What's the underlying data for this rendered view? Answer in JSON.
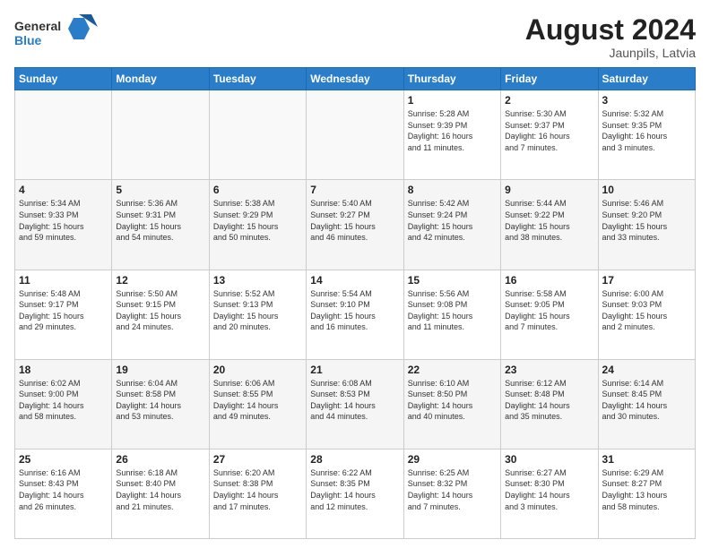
{
  "header": {
    "logo_general": "General",
    "logo_blue": "Blue",
    "month_title": "August 2024",
    "location": "Jaunpils, Latvia"
  },
  "days_of_week": [
    "Sunday",
    "Monday",
    "Tuesday",
    "Wednesday",
    "Thursday",
    "Friday",
    "Saturday"
  ],
  "weeks": [
    [
      {
        "day": "",
        "info": ""
      },
      {
        "day": "",
        "info": ""
      },
      {
        "day": "",
        "info": ""
      },
      {
        "day": "",
        "info": ""
      },
      {
        "day": "1",
        "info": "Sunrise: 5:28 AM\nSunset: 9:39 PM\nDaylight: 16 hours\nand 11 minutes."
      },
      {
        "day": "2",
        "info": "Sunrise: 5:30 AM\nSunset: 9:37 PM\nDaylight: 16 hours\nand 7 minutes."
      },
      {
        "day": "3",
        "info": "Sunrise: 5:32 AM\nSunset: 9:35 PM\nDaylight: 16 hours\nand 3 minutes."
      }
    ],
    [
      {
        "day": "4",
        "info": "Sunrise: 5:34 AM\nSunset: 9:33 PM\nDaylight: 15 hours\nand 59 minutes."
      },
      {
        "day": "5",
        "info": "Sunrise: 5:36 AM\nSunset: 9:31 PM\nDaylight: 15 hours\nand 54 minutes."
      },
      {
        "day": "6",
        "info": "Sunrise: 5:38 AM\nSunset: 9:29 PM\nDaylight: 15 hours\nand 50 minutes."
      },
      {
        "day": "7",
        "info": "Sunrise: 5:40 AM\nSunset: 9:27 PM\nDaylight: 15 hours\nand 46 minutes."
      },
      {
        "day": "8",
        "info": "Sunrise: 5:42 AM\nSunset: 9:24 PM\nDaylight: 15 hours\nand 42 minutes."
      },
      {
        "day": "9",
        "info": "Sunrise: 5:44 AM\nSunset: 9:22 PM\nDaylight: 15 hours\nand 38 minutes."
      },
      {
        "day": "10",
        "info": "Sunrise: 5:46 AM\nSunset: 9:20 PM\nDaylight: 15 hours\nand 33 minutes."
      }
    ],
    [
      {
        "day": "11",
        "info": "Sunrise: 5:48 AM\nSunset: 9:17 PM\nDaylight: 15 hours\nand 29 minutes."
      },
      {
        "day": "12",
        "info": "Sunrise: 5:50 AM\nSunset: 9:15 PM\nDaylight: 15 hours\nand 24 minutes."
      },
      {
        "day": "13",
        "info": "Sunrise: 5:52 AM\nSunset: 9:13 PM\nDaylight: 15 hours\nand 20 minutes."
      },
      {
        "day": "14",
        "info": "Sunrise: 5:54 AM\nSunset: 9:10 PM\nDaylight: 15 hours\nand 16 minutes."
      },
      {
        "day": "15",
        "info": "Sunrise: 5:56 AM\nSunset: 9:08 PM\nDaylight: 15 hours\nand 11 minutes."
      },
      {
        "day": "16",
        "info": "Sunrise: 5:58 AM\nSunset: 9:05 PM\nDaylight: 15 hours\nand 7 minutes."
      },
      {
        "day": "17",
        "info": "Sunrise: 6:00 AM\nSunset: 9:03 PM\nDaylight: 15 hours\nand 2 minutes."
      }
    ],
    [
      {
        "day": "18",
        "info": "Sunrise: 6:02 AM\nSunset: 9:00 PM\nDaylight: 14 hours\nand 58 minutes."
      },
      {
        "day": "19",
        "info": "Sunrise: 6:04 AM\nSunset: 8:58 PM\nDaylight: 14 hours\nand 53 minutes."
      },
      {
        "day": "20",
        "info": "Sunrise: 6:06 AM\nSunset: 8:55 PM\nDaylight: 14 hours\nand 49 minutes."
      },
      {
        "day": "21",
        "info": "Sunrise: 6:08 AM\nSunset: 8:53 PM\nDaylight: 14 hours\nand 44 minutes."
      },
      {
        "day": "22",
        "info": "Sunrise: 6:10 AM\nSunset: 8:50 PM\nDaylight: 14 hours\nand 40 minutes."
      },
      {
        "day": "23",
        "info": "Sunrise: 6:12 AM\nSunset: 8:48 PM\nDaylight: 14 hours\nand 35 minutes."
      },
      {
        "day": "24",
        "info": "Sunrise: 6:14 AM\nSunset: 8:45 PM\nDaylight: 14 hours\nand 30 minutes."
      }
    ],
    [
      {
        "day": "25",
        "info": "Sunrise: 6:16 AM\nSunset: 8:43 PM\nDaylight: 14 hours\nand 26 minutes."
      },
      {
        "day": "26",
        "info": "Sunrise: 6:18 AM\nSunset: 8:40 PM\nDaylight: 14 hours\nand 21 minutes."
      },
      {
        "day": "27",
        "info": "Sunrise: 6:20 AM\nSunset: 8:38 PM\nDaylight: 14 hours\nand 17 minutes."
      },
      {
        "day": "28",
        "info": "Sunrise: 6:22 AM\nSunset: 8:35 PM\nDaylight: 14 hours\nand 12 minutes."
      },
      {
        "day": "29",
        "info": "Sunrise: 6:25 AM\nSunset: 8:32 PM\nDaylight: 14 hours\nand 7 minutes."
      },
      {
        "day": "30",
        "info": "Sunrise: 6:27 AM\nSunset: 8:30 PM\nDaylight: 14 hours\nand 3 minutes."
      },
      {
        "day": "31",
        "info": "Sunrise: 6:29 AM\nSunset: 8:27 PM\nDaylight: 13 hours\nand 58 minutes."
      }
    ]
  ]
}
